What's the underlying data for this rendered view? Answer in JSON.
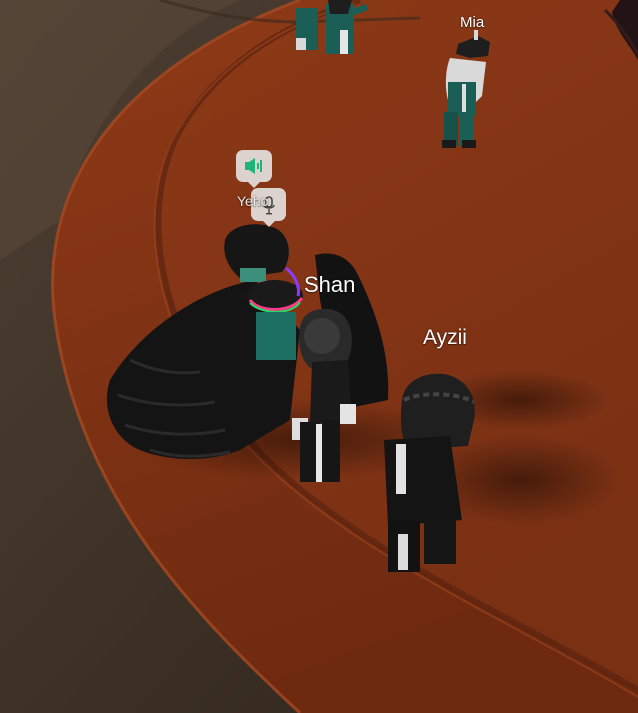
{
  "players": [
    {
      "name": "Mia"
    },
    {
      "name": "Yeho"
    },
    {
      "name": "Shan"
    },
    {
      "name": "Ayzii"
    }
  ],
  "voice_chat": {
    "speaker_icon": "speaker-volume-icon",
    "mic_icon": "microphone-icon",
    "speaker_color": "#1fb57a",
    "mic_color": "#444444"
  },
  "colors": {
    "floor": "#8a3616",
    "outer_ground": "#4a3a2c",
    "tier_edge": "#5a2410",
    "avatar_dark": "#1c1c1c",
    "avatar_teal": "#1b5e55"
  }
}
